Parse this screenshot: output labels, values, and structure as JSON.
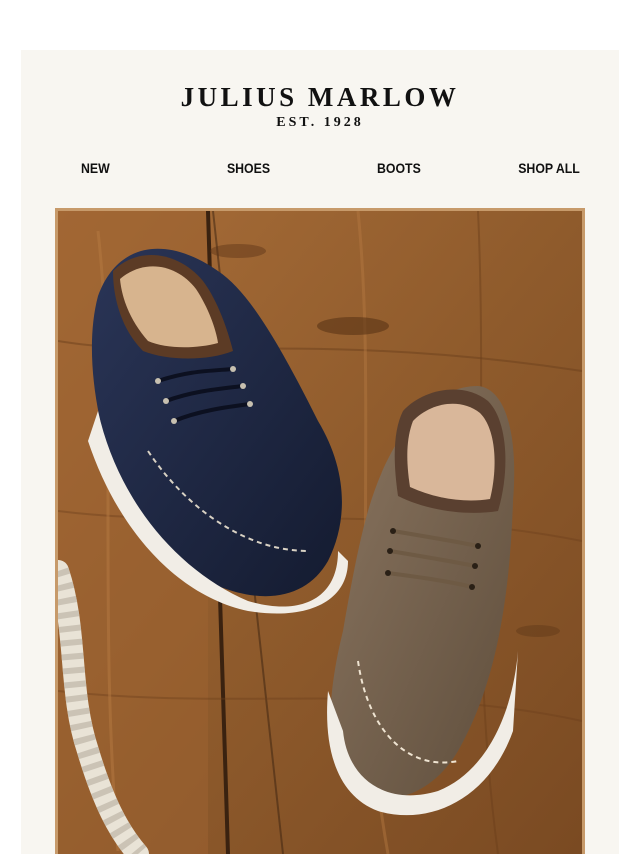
{
  "brand": {
    "name": "JULIUS MARLOW",
    "established": "EST. 1928"
  },
  "nav": {
    "items": [
      {
        "label": "NEW"
      },
      {
        "label": "SHOES"
      },
      {
        "label": "BOOTS"
      },
      {
        "label": "SHOP ALL"
      }
    ]
  },
  "hero": {
    "subject": "navy and olive suede boat shoes on wooden deck with rope",
    "colors": {
      "frame": "#c79a6a",
      "wood": "#9a6433",
      "navy_suede": "#1c2540",
      "olive_suede": "#7a6650",
      "sole": "#f1ede6"
    }
  }
}
